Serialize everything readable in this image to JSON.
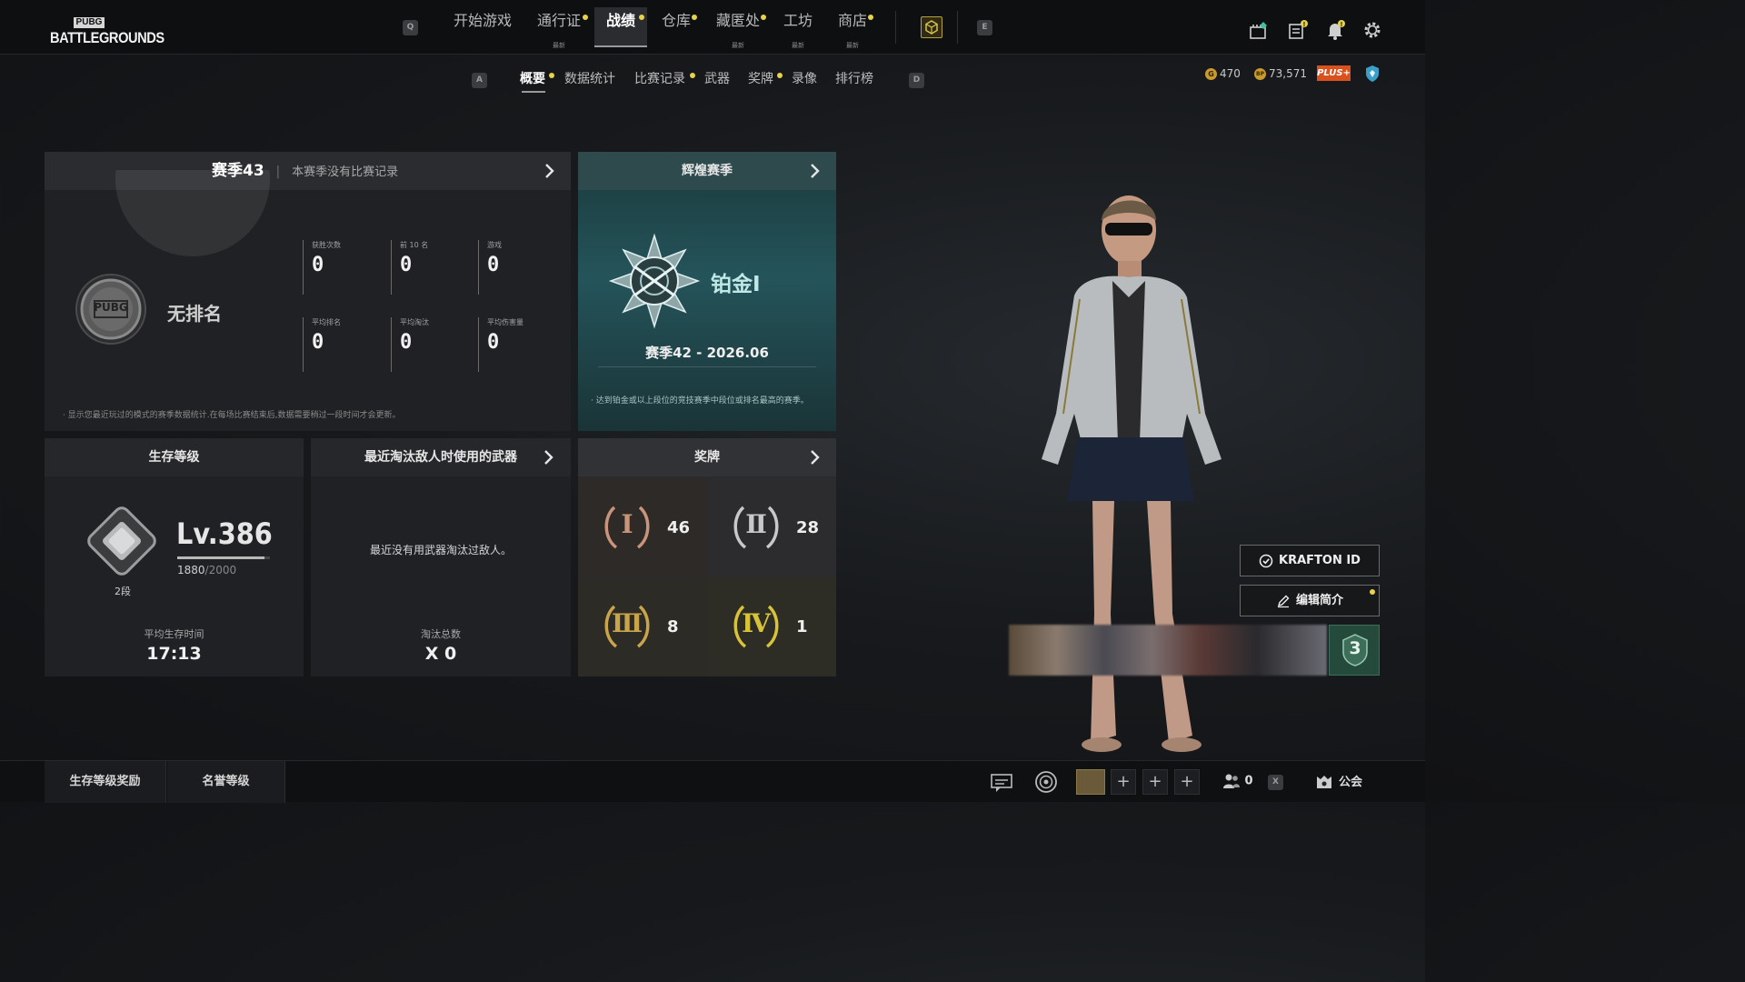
{
  "top_nav": {
    "logo_top": "PUBG",
    "logo_bottom": "BATTLEGROUNDS",
    "key_left": "Q",
    "key_right": "E",
    "items": [
      {
        "label": "开始游戏",
        "sub": ""
      },
      {
        "label": "通行证",
        "sub": "最新"
      },
      {
        "label": "战绩",
        "sub": ""
      },
      {
        "label": "仓库",
        "sub": ""
      },
      {
        "label": "藏匿处",
        "sub": "最新"
      },
      {
        "label": "工坊",
        "sub": "最新"
      },
      {
        "label": "商店",
        "sub": "最新"
      }
    ],
    "icons": [
      "pass-box-icon",
      "store-icon",
      "news-icon",
      "bell-icon",
      "gear-icon"
    ]
  },
  "sub_nav": {
    "key_left": "A",
    "key_right": "D",
    "items": [
      "概要",
      "数据统计",
      "比赛记录",
      "武器",
      "奖牌",
      "录像",
      "排行榜"
    ]
  },
  "currency": {
    "g_coin_label": "G",
    "g_coin": "470",
    "bp_label": "BP",
    "bp": "73,571",
    "plus_badge": "PLUS+"
  },
  "season_panel": {
    "title": "赛季43",
    "subtitle": "本赛季没有比赛记录",
    "badge_text": "PUBG",
    "rank": "无排名",
    "stats": [
      {
        "label": "获胜次数",
        "value": "0"
      },
      {
        "label": "前 10 名",
        "value": "0"
      },
      {
        "label": "游戏",
        "value": "0"
      },
      {
        "label": "平均排名",
        "value": "0"
      },
      {
        "label": "平均淘汰",
        "value": "0"
      },
      {
        "label": "平均伤害量",
        "value": "0"
      }
    ],
    "note": "显示您最近玩过的模式的赛季数据统计.在每场比赛结束后,数据需要稍过一段时间才会更新。"
  },
  "glory_panel": {
    "title": "辉煌赛季",
    "tier": "铂金Ⅰ",
    "season": "赛季42 - 2026.06",
    "note": "达到铂金或以上段位的竞技赛季中段位或排名最高的赛季。"
  },
  "survival_panel": {
    "title": "生存等级",
    "level": "Lv.386",
    "xp_current": "1880",
    "xp_total": "/2000",
    "xp_progress": 0.94,
    "tier": "2段",
    "avg_time_label": "平均生存时间",
    "avg_time": "17:13"
  },
  "weapon_panel": {
    "title": "最近淘汰敌人时使用的武器",
    "empty": "最近没有用武器淘汰过敌人。",
    "kills_label": "淘汰总数",
    "kills": "X 0"
  },
  "medal_panel": {
    "title": "奖牌",
    "medals": [
      {
        "numeral": "Ⅰ",
        "count": "46",
        "color": "#c8947a"
      },
      {
        "numeral": "Ⅱ",
        "count": "28",
        "color": "#c8c8c8"
      },
      {
        "numeral": "Ⅲ",
        "count": "8",
        "color": "#c9a44a"
      },
      {
        "numeral": "Ⅳ",
        "count": "1",
        "color": "#d8c23a"
      }
    ]
  },
  "profile": {
    "krafton_id": "KRAFTON ID",
    "edit_intro": "编辑简介",
    "nameplate_level": "3"
  },
  "bottom_bar": {
    "tabs": [
      "生存等级奖励",
      "名誉等级"
    ],
    "party_count": "0",
    "party_x": "X",
    "guild": "公会"
  },
  "colors": {
    "accent_dot": "#e8d24a",
    "plus_badge": "#d9521e",
    "glory_teal": "#1f4a4c",
    "tier_text": "#bfe8e6"
  }
}
